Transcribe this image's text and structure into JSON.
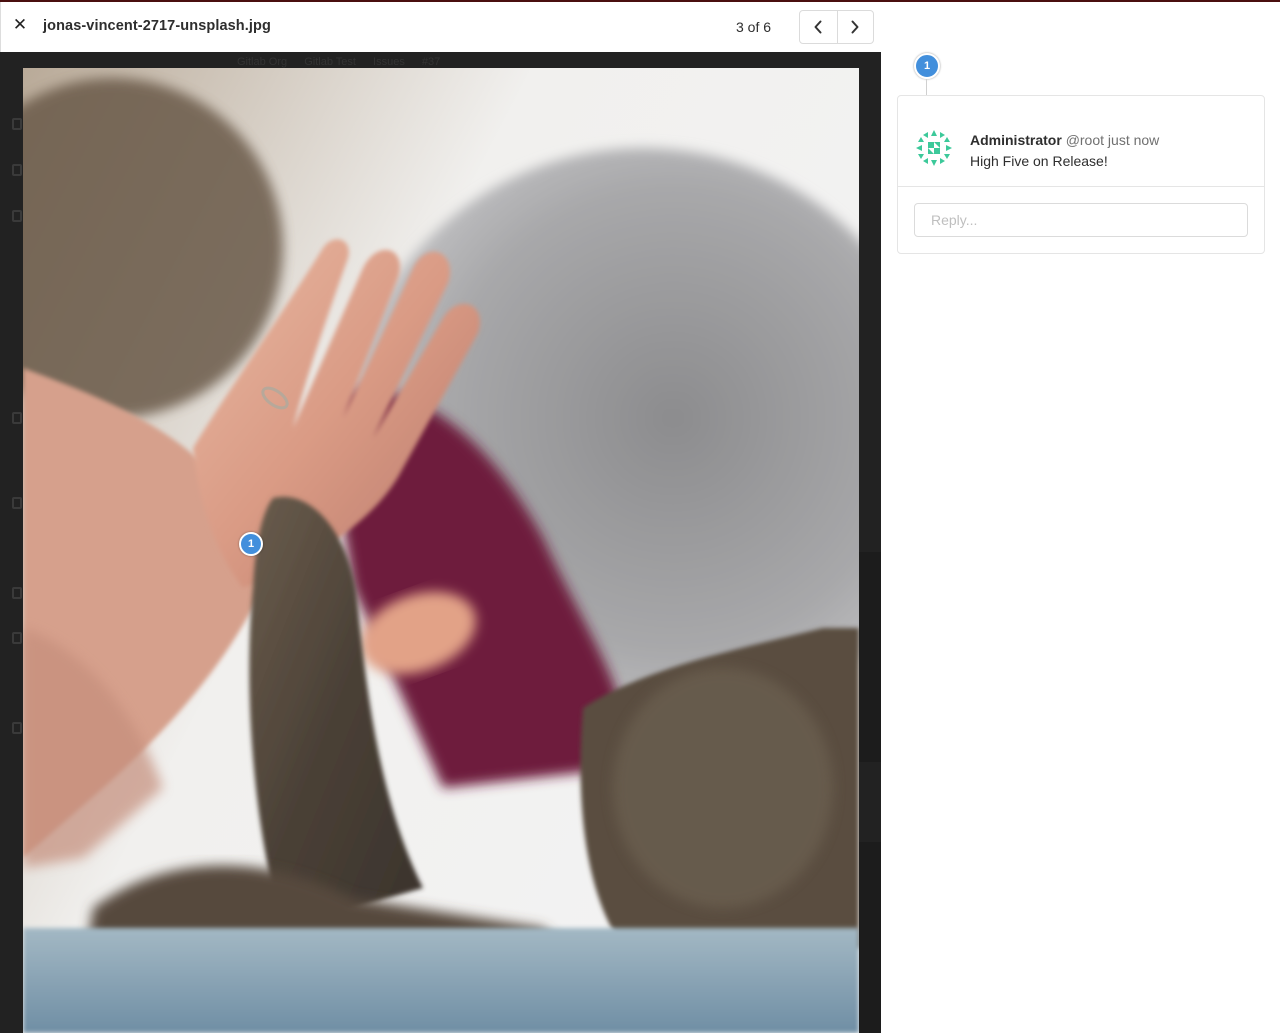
{
  "viewer": {
    "filename": "jonas-vincent-2717-unsplash.jpg",
    "counter": "3 of 6",
    "close_icon": "close-icon",
    "prev_icon": "chevron-left-icon",
    "next_icon": "chevron-right-icon"
  },
  "image": {
    "pin_label": "1"
  },
  "discussion": {
    "pin_label": "1",
    "author_name": "Administrator",
    "author_handle": "@root",
    "timestamp": "just now",
    "body": "High Five on Release!",
    "reply_placeholder": "Reply..."
  },
  "background_page": {
    "breadcrumbs": [
      "Gitlab Org",
      "Gitlab Test",
      "Issues",
      "#37"
    ]
  },
  "colors": {
    "pin": "#428fdc",
    "backdrop": "#222222",
    "avatar": "#3cc99a"
  }
}
